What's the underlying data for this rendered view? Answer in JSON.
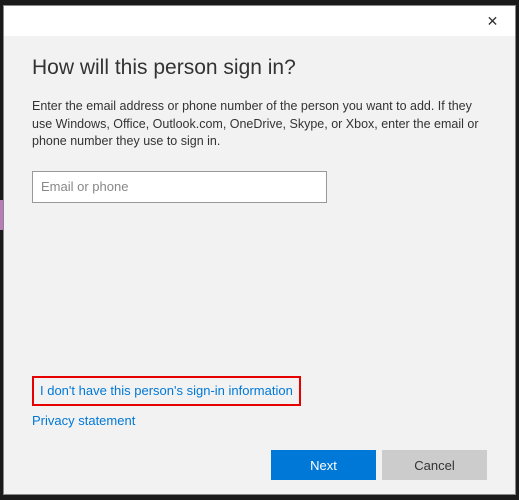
{
  "dialog": {
    "heading": "How will this person sign in?",
    "description": "Enter the email address or phone number of the person you want to add. If they use Windows, Office, Outlook.com, OneDrive, Skype, or Xbox, enter the email or phone number they use to sign in.",
    "input": {
      "placeholder": "Email or phone",
      "value": ""
    },
    "links": {
      "no_signin_info": "I don't have this person's sign-in information",
      "privacy": "Privacy statement"
    },
    "buttons": {
      "next": "Next",
      "cancel": "Cancel"
    }
  }
}
